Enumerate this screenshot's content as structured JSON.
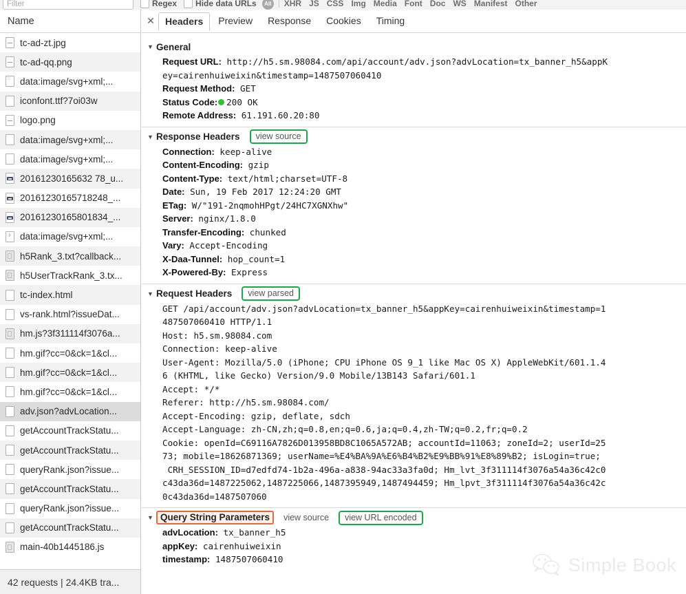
{
  "toolbar": {
    "filter_placeholder": "Filter",
    "regex_label": "Regex",
    "hide_data_urls_label": "Hide data URLs",
    "all_label": "All",
    "types": [
      "XHR",
      "JS",
      "CSS",
      "Img",
      "Media",
      "Font",
      "Doc",
      "WS",
      "Manifest",
      "Other"
    ]
  },
  "sidebar": {
    "column_header": "Name",
    "summary": "42 requests | 24.4KB tra...",
    "files": [
      {
        "name": "tc-ad-zt.jpg",
        "icon": "image-file-icon"
      },
      {
        "name": "tc-ad-qq.png",
        "icon": "image-file-icon"
      },
      {
        "name": "data:image/svg+xml;...",
        "icon": "svg-file-icon"
      },
      {
        "name": "iconfont.ttf?7oi03w",
        "icon": "font-file-icon"
      },
      {
        "name": "logo.png",
        "icon": "image-file-icon"
      },
      {
        "name": "data:image/svg+xml;...",
        "icon": "doc-file-icon"
      },
      {
        "name": "data:image/svg+xml;...",
        "icon": "doc-file-icon"
      },
      {
        "name": "20161230165632 78_u...",
        "icon": "media-file-icon"
      },
      {
        "name": "20161230165718248_...",
        "icon": "media-file-icon"
      },
      {
        "name": "20161230165801834_...",
        "icon": "media-file-icon"
      },
      {
        "name": "data:image/svg+xml;...",
        "icon": "chevron-file-icon"
      },
      {
        "name": "h5Rank_3.txt?callback...",
        "icon": "script-file-icon"
      },
      {
        "name": "h5UserTrackRank_3.tx...",
        "icon": "script-file-icon"
      },
      {
        "name": "tc-index.html",
        "icon": "doc-file-icon"
      },
      {
        "name": "vs-rank.html?issueDat...",
        "icon": "doc-file-icon"
      },
      {
        "name": "hm.js?3f311114f3076a...",
        "icon": "script-file-icon"
      },
      {
        "name": "hm.gif?cc=0&ck=1&cl...",
        "icon": "doc-file-icon"
      },
      {
        "name": "hm.gif?cc=0&ck=1&cl...",
        "icon": "doc-file-icon"
      },
      {
        "name": "hm.gif?cc=0&ck=1&cl...",
        "icon": "doc-file-icon"
      },
      {
        "name": "adv.json?advLocation...",
        "icon": "doc-file-icon",
        "selected": true
      },
      {
        "name": "getAccountTrackStatu...",
        "icon": "doc-file-icon"
      },
      {
        "name": "getAccountTrackStatu...",
        "icon": "doc-file-icon"
      },
      {
        "name": "queryRank.json?issue...",
        "icon": "doc-file-icon"
      },
      {
        "name": "getAccountTrackStatu...",
        "icon": "doc-file-icon"
      },
      {
        "name": "queryRank.json?issue...",
        "icon": "doc-file-icon"
      },
      {
        "name": "getAccountTrackStatu...",
        "icon": "doc-file-icon"
      },
      {
        "name": "main-40b1445186.js",
        "icon": "script-file-icon"
      }
    ]
  },
  "detail": {
    "tabs": [
      {
        "label": "Headers",
        "active": true
      },
      {
        "label": "Preview",
        "active": false
      },
      {
        "label": "Response",
        "active": false
      },
      {
        "label": "Cookies",
        "active": false
      },
      {
        "label": "Timing",
        "active": false
      }
    ],
    "general": {
      "title": "General",
      "request_url_key": "Request URL:",
      "request_url_line1": " http://h5.sm.98084.com/api/account/adv.json?advLocation=tx_banner_h5&appK",
      "request_url_line2": "ey=cairenhuiweixin&timestamp=1487507060410",
      "request_method_key": "Request Method:",
      "request_method_value": " GET",
      "status_code_key": "Status Code:",
      "status_code_value": "200 OK",
      "status_color": "#30c030",
      "remote_address_key": "Remote Address:",
      "remote_address_value": " 61.191.60.20:80"
    },
    "response_headers": {
      "title": "Response Headers",
      "action_label": "view source",
      "action_highlight_color": "#17a94a",
      "items": [
        {
          "key": "Connection:",
          "value": " keep-alive"
        },
        {
          "key": "Content-Encoding:",
          "value": " gzip"
        },
        {
          "key": "Content-Type:",
          "value": " text/html;charset=UTF-8"
        },
        {
          "key": "Date:",
          "value": " Sun, 19 Feb 2017 12:24:20 GMT"
        },
        {
          "key": "ETag:",
          "value": " W/\"191-2nqmohHPgt/24HC7XGNXhw\""
        },
        {
          "key": "Server:",
          "value": " nginx/1.8.0"
        },
        {
          "key": "Transfer-Encoding:",
          "value": " chunked"
        },
        {
          "key": "Vary:",
          "value": " Accept-Encoding"
        },
        {
          "key": "X-Daa-Tunnel:",
          "value": " hop_count=1"
        },
        {
          "key": "X-Powered-By:",
          "value": " Express"
        }
      ]
    },
    "request_headers": {
      "title": "Request Headers",
      "action_label": "view parsed",
      "action_highlight_color": "#17a94a",
      "lines": [
        "GET /api/account/adv.json?advLocation=tx_banner_h5&appKey=cairenhuiweixin&timestamp=1",
        "487507060410 HTTP/1.1",
        "Host: h5.sm.98084.com",
        "Connection: keep-alive",
        "User-Agent: Mozilla/5.0 (iPhone; CPU iPhone OS 9_1 like Mac OS X) AppleWebKit/601.1.4",
        "6 (KHTML, like Gecko) Version/9.0 Mobile/13B143 Safari/601.1",
        "Accept: */*",
        "Referer: http://h5.sm.98084.com/",
        "Accept-Encoding: gzip, deflate, sdch",
        "Accept-Language: zh-CN,zh;q=0.8,en;q=0.6,ja;q=0.4,zh-TW;q=0.2,fr;q=0.2",
        "Cookie: openId=C69116A7826D013958BD8C1065A572AB; accountId=11063; zoneId=2; userId=25",
        "73; mobile=18626871369; userName=%E4%BA%9A%E6%B4%B2%E9%BB%91%E8%89%B2; isLogin=true;",
        " CRH_SESSION_ID=d7edfd74-1b2a-496a-a838-94ac33a3fa0d; Hm_lvt_3f311114f3076a54a36c42c0",
        "c43da36d=1487225062,1487225066,1487395949,1487494459; Hm_lpvt_3f311114f3076a54a36c42c",
        "0c43da36d=1487507060"
      ]
    },
    "query_string": {
      "title": "Query String Parameters",
      "title_highlight_color": "#e06a38",
      "action_plain_label": "view source",
      "action_label": "view URL encoded",
      "action_highlight_color": "#17a94a",
      "items": [
        {
          "key": "advLocation:",
          "value": " tx_banner_h5"
        },
        {
          "key": "appKey:",
          "value": " cairenhuiweixin"
        },
        {
          "key": "timestamp:",
          "value": " 1487507060410"
        }
      ]
    }
  },
  "watermark": {
    "text": "Simple Book",
    "icon": "wechat-icon"
  }
}
